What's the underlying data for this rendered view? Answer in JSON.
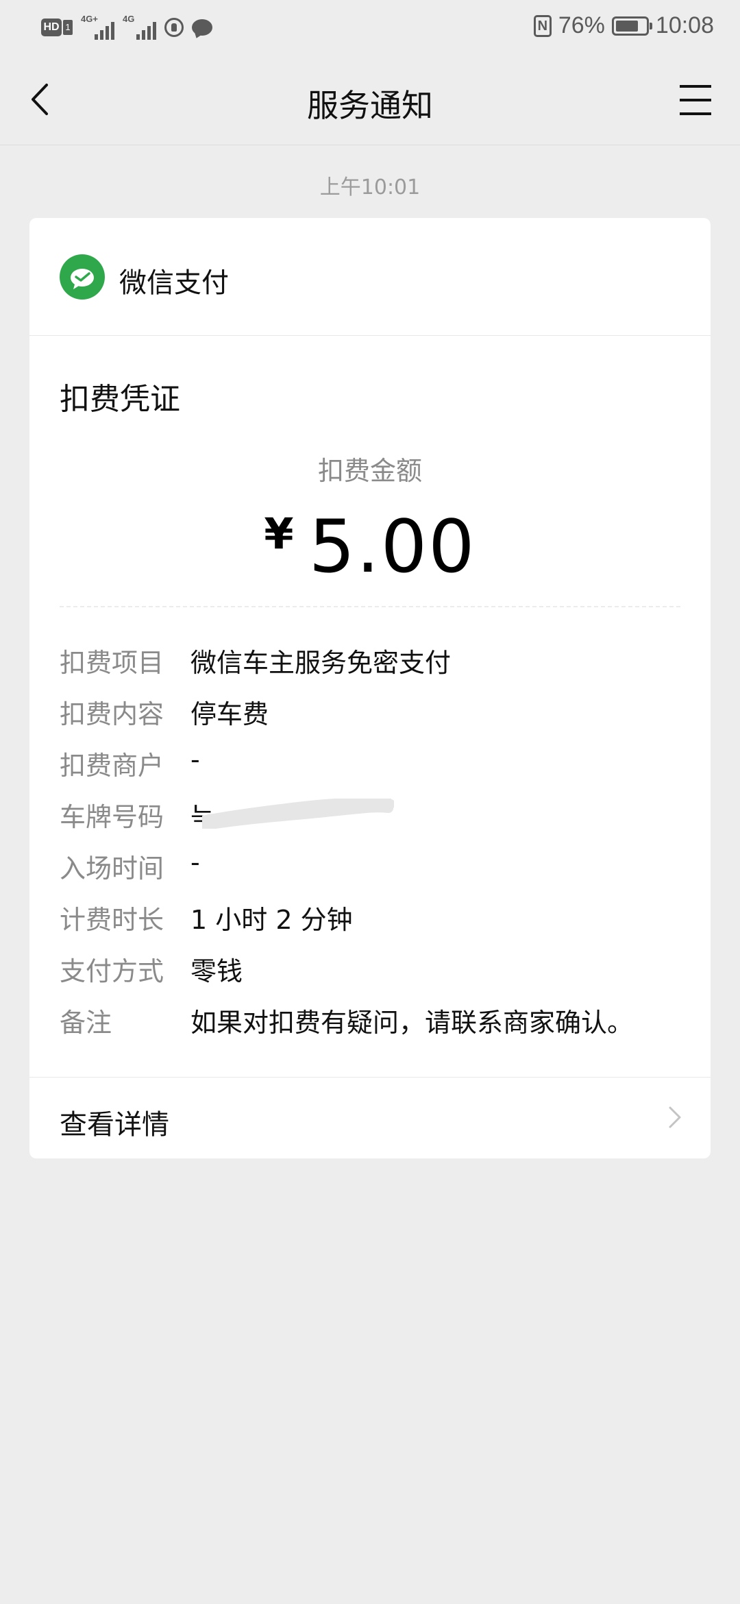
{
  "status_bar": {
    "hd_label": "HD",
    "hd_sim": "1",
    "net1_tag": "4G+",
    "net2_tag": "4G",
    "battery": "76%",
    "battery_level": 0.76,
    "time": "10:08",
    "nfc_label": "N"
  },
  "nav": {
    "title": "服务通知"
  },
  "message": {
    "timestamp": "上午10:01"
  },
  "card": {
    "payment_provider": "微信支付",
    "title": "扣费凭证",
    "amount_label": "扣费金额",
    "amount_currency": "¥",
    "amount_value": "5.00",
    "details": [
      {
        "label": "扣费项目",
        "value": "微信车主服务免密支付"
      },
      {
        "label": "扣费内容",
        "value": "停车费"
      },
      {
        "label": "扣费商户",
        "value": "-"
      },
      {
        "label": "车牌号码",
        "value": "늑"
      },
      {
        "label": "入场时间",
        "value": "-"
      },
      {
        "label": "计费时长",
        "value": "1 小时 2 分钟"
      },
      {
        "label": "支付方式",
        "value": "零钱"
      },
      {
        "label": "备注",
        "value": "如果对扣费有疑问，请联系商家确认。"
      }
    ],
    "view_details_label": "查看详情"
  },
  "colors": {
    "background": "#ededed",
    "card": "#ffffff",
    "wechat_pay_green": "#2ea84a",
    "secondary_text": "#8a8a8a"
  }
}
